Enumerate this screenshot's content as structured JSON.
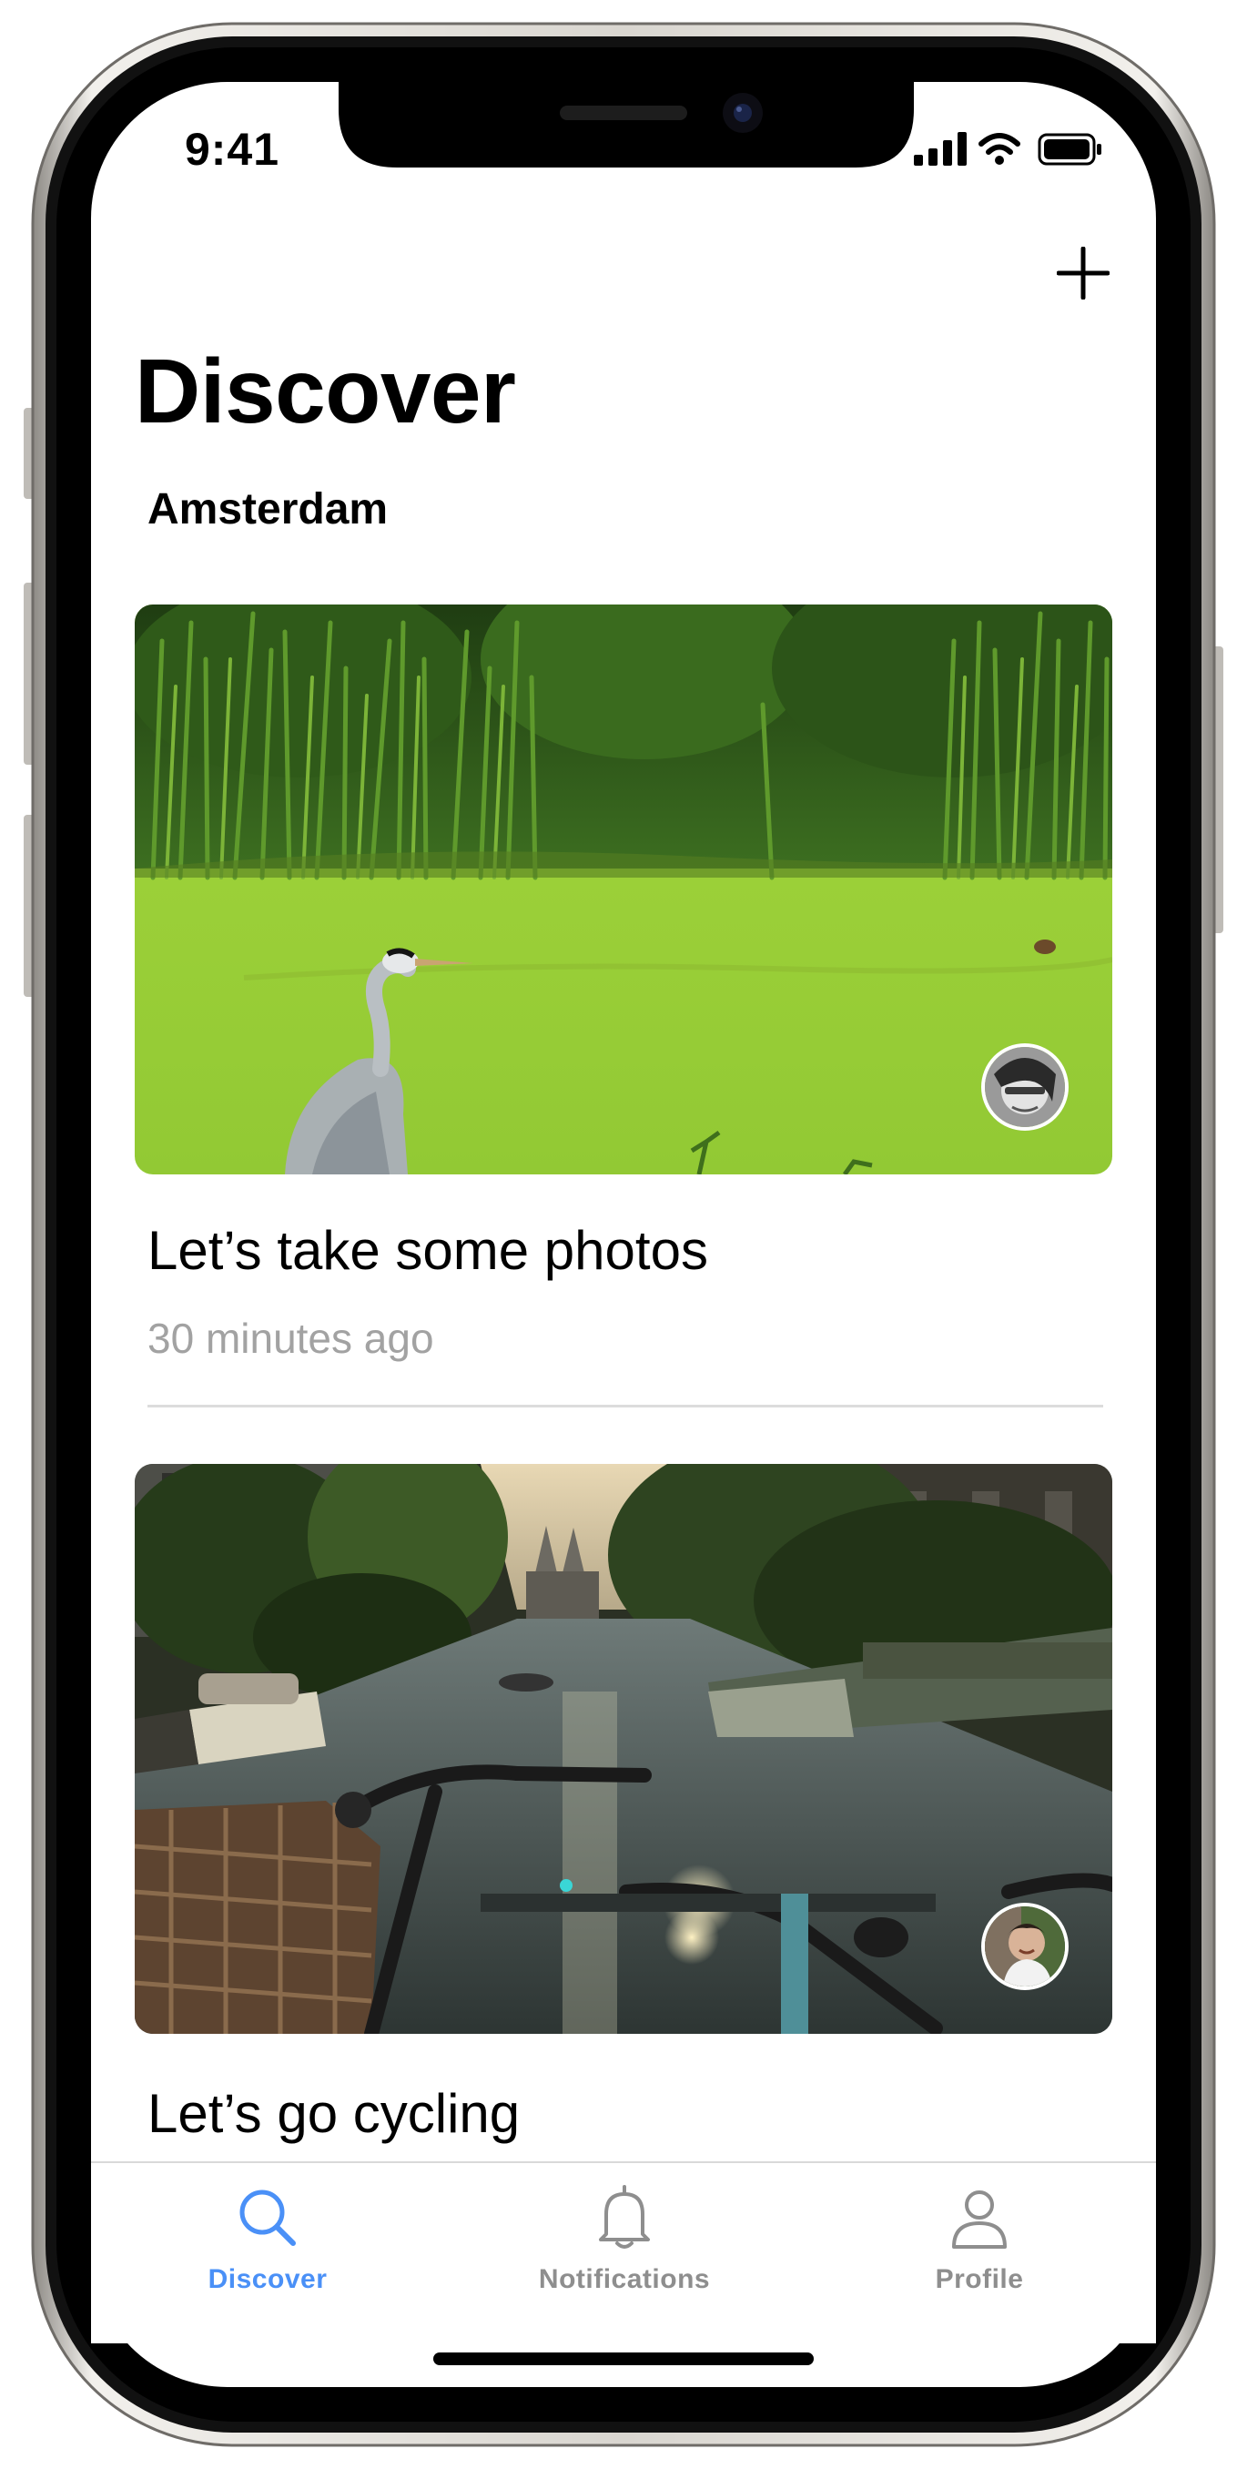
{
  "status_bar": {
    "time": "9:41"
  },
  "header": {
    "add_icon": "plus-icon",
    "title": "Discover",
    "subtitle": "Amsterdam"
  },
  "feed": {
    "posts": [
      {
        "title": "Let’s take some photos",
        "time": "30 minutes ago",
        "image": "heron-in-duckweed-canal-photo",
        "avatar": "user-avatar-photo"
      },
      {
        "title": "Let’s go cycling",
        "image": "bicycles-on-canal-bridge-photo",
        "avatar": "user-avatar-photo"
      }
    ]
  },
  "tab_bar": {
    "tabs": [
      {
        "label": "Discover",
        "icon": "search-icon",
        "active": true
      },
      {
        "label": "Notifications",
        "icon": "bell-icon",
        "active": false
      },
      {
        "label": "Profile",
        "icon": "person-icon",
        "active": false
      }
    ],
    "active_color": "#4a90f7",
    "inactive_color": "#8e8e8e"
  }
}
